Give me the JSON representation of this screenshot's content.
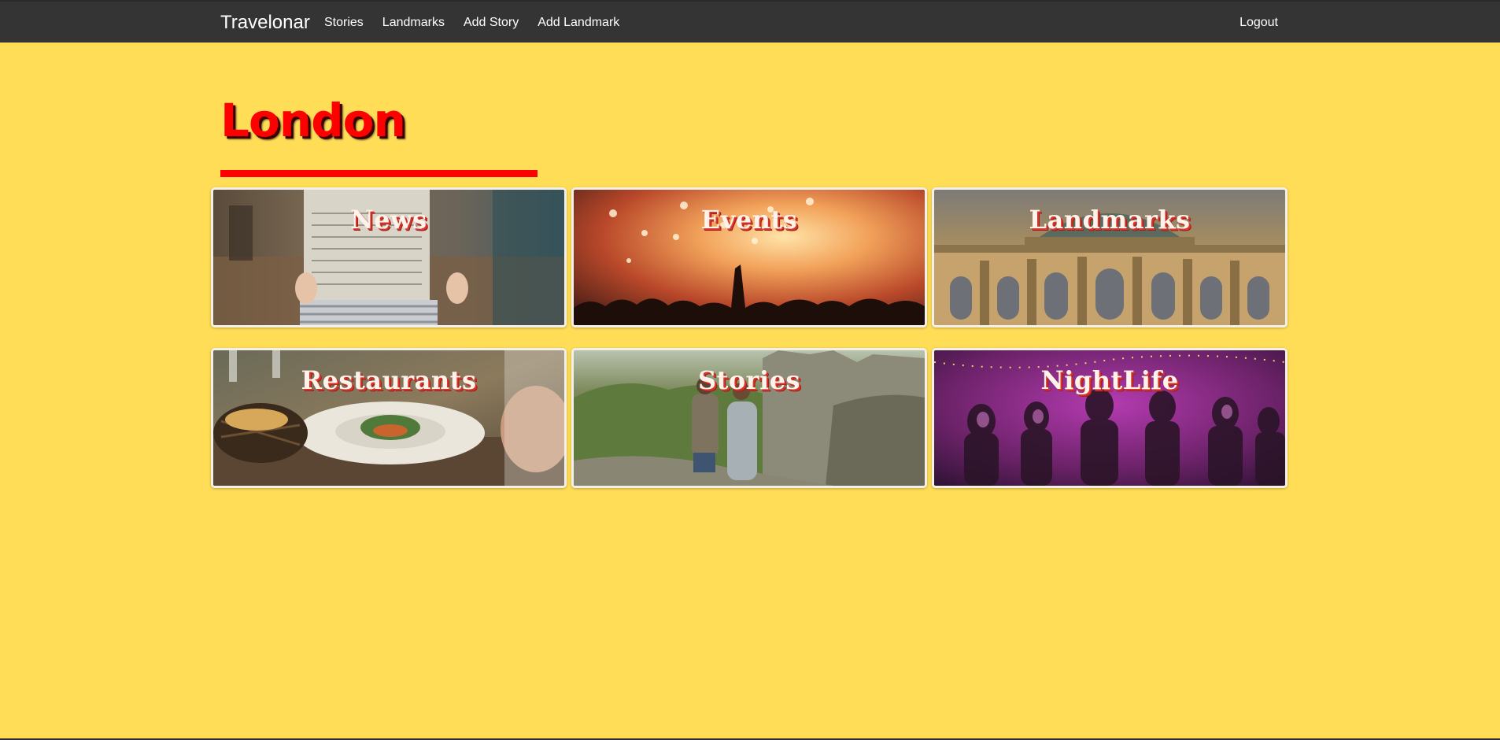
{
  "navbar": {
    "brand": "Travelonar",
    "links": [
      "Stories",
      "Landmarks",
      "Add Story",
      "Add Landmark"
    ],
    "logout": "Logout"
  },
  "page": {
    "title": "London"
  },
  "categories": [
    {
      "label": "News",
      "icon": "news-photo"
    },
    {
      "label": "Events",
      "icon": "concert-photo"
    },
    {
      "label": "Landmarks",
      "icon": "palace-photo"
    },
    {
      "label": "Restaurants",
      "icon": "restaurant-photo"
    },
    {
      "label": "Stories",
      "icon": "landscape-photo"
    },
    {
      "label": "NightLife",
      "icon": "nightlife-photo"
    }
  ],
  "colors": {
    "background": "#FFDD57",
    "navbar": "#343434",
    "accent": "#FF0000"
  }
}
